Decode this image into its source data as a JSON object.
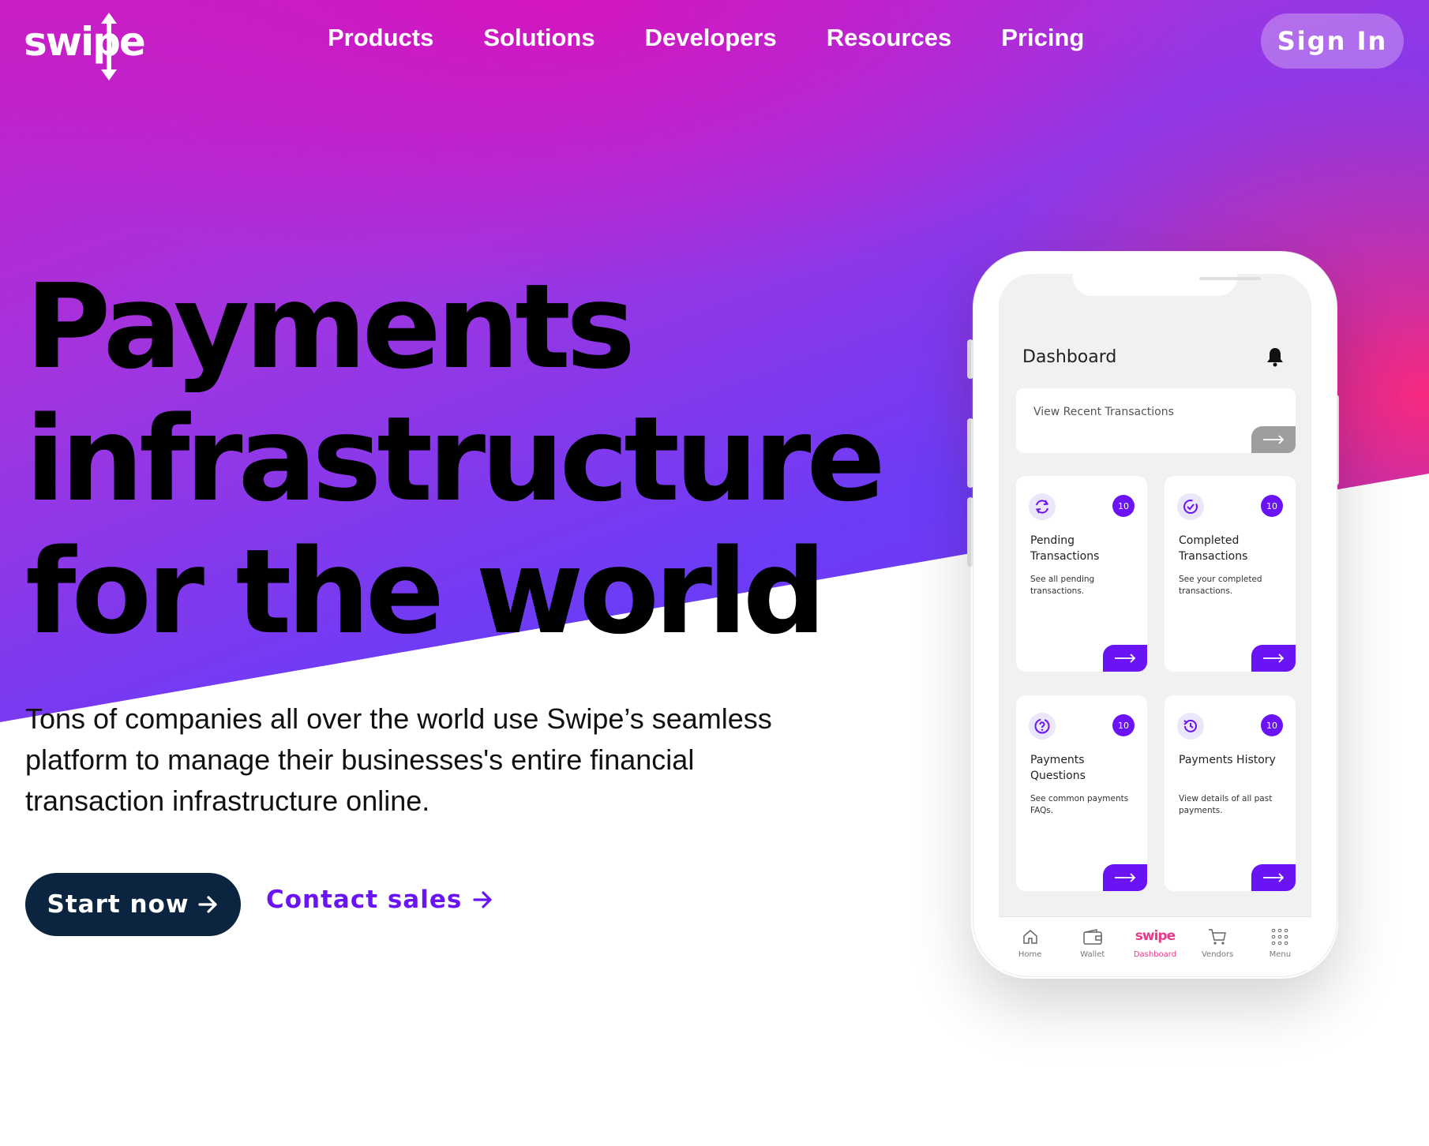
{
  "brand": {
    "logo_text": "swipe"
  },
  "nav": {
    "links": [
      "Products",
      "Solutions",
      "Developers",
      "Resources",
      "Pricing"
    ],
    "signin_label": "Sign In"
  },
  "hero": {
    "headline_lines": [
      "Payments",
      "infrastructure",
      "for the world"
    ],
    "subtext": "Tons of companies all over the world use Swipe’s seamless platform to manage their businesses's entire financial transaction infrastructure online.",
    "primary_cta": "Start now",
    "secondary_cta": "Contact sales"
  },
  "phone": {
    "dashboard_title": "Dashboard",
    "recent_label": "View Recent Transactions",
    "cards": [
      {
        "title": "Pending Transactions",
        "desc": "See all pending transactions.",
        "badge": "10",
        "icon": "sync-icon"
      },
      {
        "title": "Completed Transactions",
        "desc": "See your completed transactions.",
        "badge": "10",
        "icon": "check-circle-icon"
      },
      {
        "title": "Payments Questions",
        "desc": "See common payments FAQs.",
        "badge": "10",
        "icon": "question-icon"
      },
      {
        "title": "Payments History",
        "desc": "View details of all past payments.",
        "badge": "10",
        "icon": "history-icon"
      }
    ],
    "tabs": [
      {
        "label": "Home",
        "icon": "home-icon"
      },
      {
        "label": "Wallet",
        "icon": "wallet-icon"
      },
      {
        "label": "Dashboard",
        "icon": "swipe-logo",
        "logo_text": "swipe",
        "active": true
      },
      {
        "label": "Vendors",
        "icon": "cart-icon"
      },
      {
        "label": "Menu",
        "icon": "grid-icon"
      }
    ]
  },
  "colors": {
    "accent": "#6a14f5",
    "cta_dark": "#0b2540",
    "pink": "#e83a8a"
  }
}
